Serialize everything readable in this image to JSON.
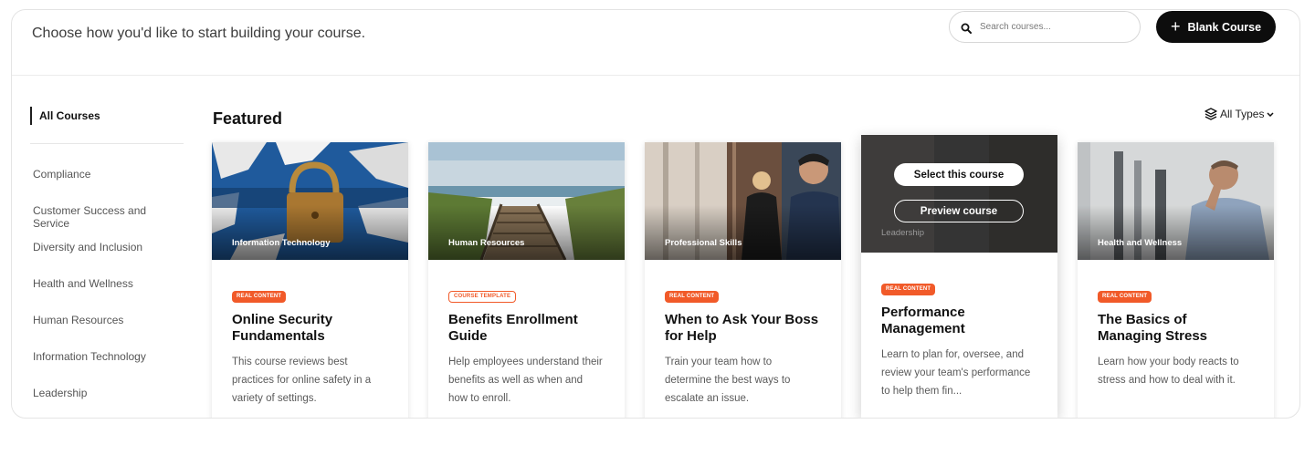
{
  "header": {
    "prompt": "Choose how you'd like to start building your course.",
    "search_placeholder": "Search courses...",
    "blank_course_label": "Blank Course"
  },
  "sidebar": {
    "active": "All Courses",
    "items": [
      "Compliance",
      "Customer Success and Service",
      "Diversity and Inclusion",
      "Health and Wellness",
      "Human Resources",
      "Information Technology",
      "Leadership"
    ]
  },
  "main": {
    "section_title": "Featured",
    "filter_label": "All Types"
  },
  "cards": [
    {
      "category": "Information Technology",
      "badge": "REAL CONTENT",
      "title": "Online Security Fundamentals",
      "description": "This course reviews best practices for online safety in a variety of settings."
    },
    {
      "category": "Human Resources",
      "badge": "COURSE TEMPLATE",
      "title": "Benefits Enrollment Guide",
      "description": "Help employees understand their benefits as well as when and how to enroll."
    },
    {
      "category": "Professional Skills",
      "badge": "REAL CONTENT",
      "title": "When to Ask Your Boss for Help",
      "description": "Train your team how to determine the best ways to escalate an issue."
    },
    {
      "category": "Leadership",
      "badge": "REAL CONTENT",
      "title": "Performance Management",
      "description": "Learn to plan for, oversee, and review your team's performance to help them fin...",
      "select_label": "Select this course",
      "preview_label": "Preview course"
    },
    {
      "category": "Health and Wellness",
      "badge": "REAL CONTENT",
      "title": "The Basics of Managing Stress",
      "description": "Learn how your body reacts to stress and how to deal with it."
    }
  ],
  "colors": {
    "accent": "#f15a29",
    "button_dark": "#0d0d0d"
  }
}
